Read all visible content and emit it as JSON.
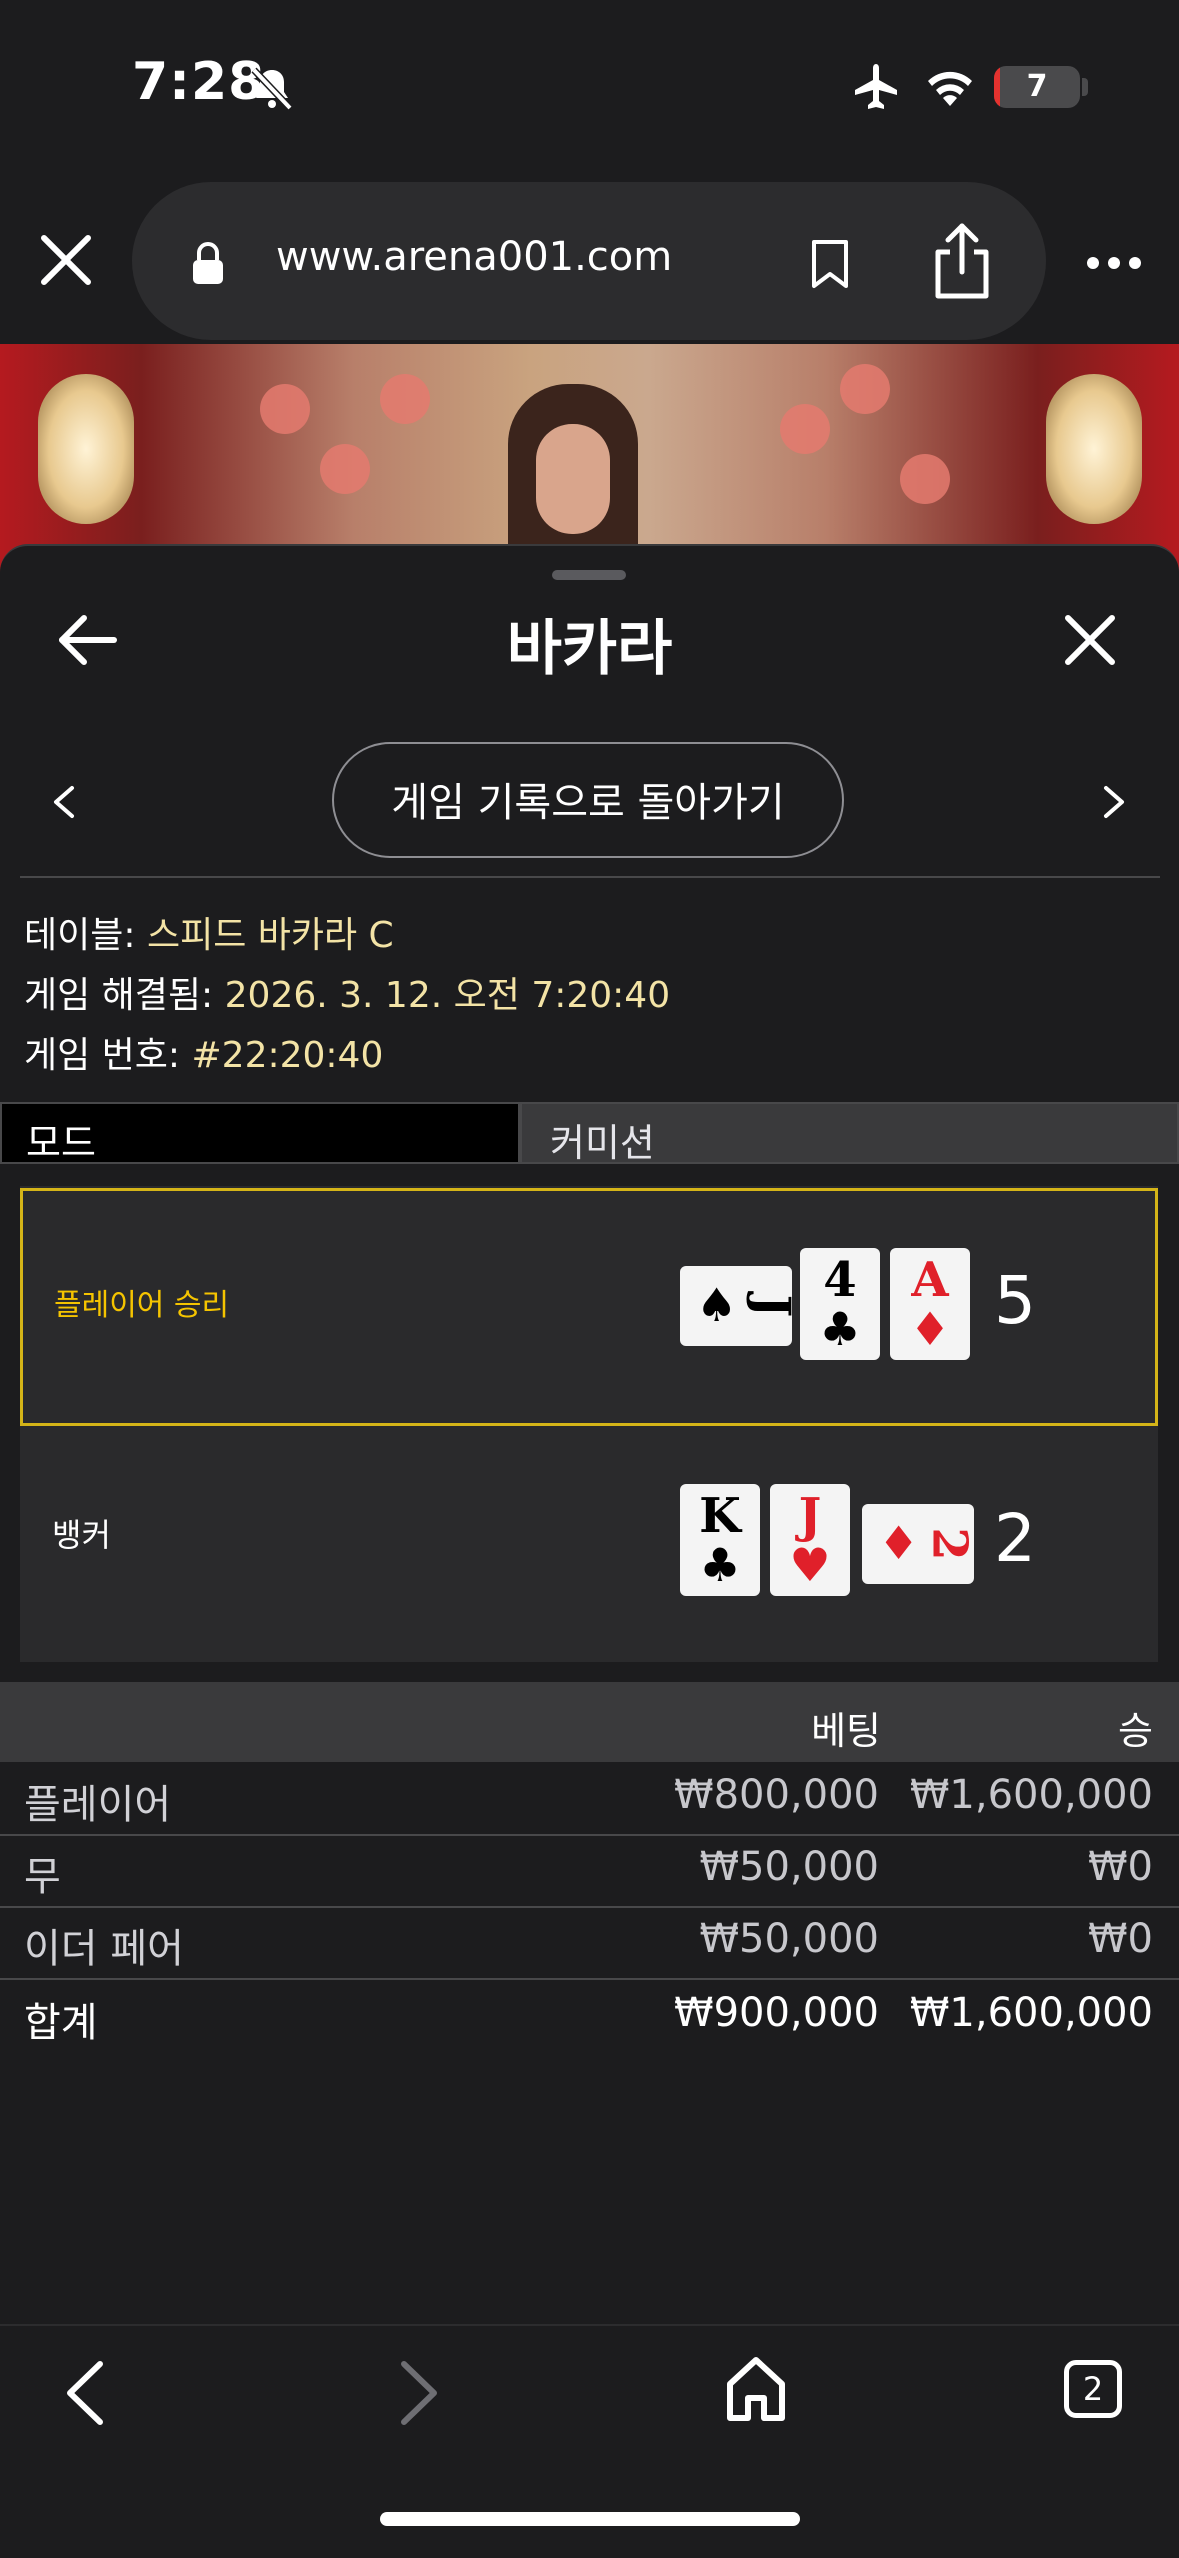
{
  "status_bar": {
    "time": "7:28",
    "battery": "7",
    "battery_level": 0.07
  },
  "browser": {
    "url": "www.arena001.com"
  },
  "sheet": {
    "title": "바카라",
    "back_to_history": "게임 기록으로 돌아가기"
  },
  "info": {
    "table_label": "테이블:",
    "table_value": "스피드 바카라 C",
    "resolved_label": "게임 해결됨:",
    "resolved_value": "2026. 3. 12. 오전 7:20:40",
    "game_no_label": "게임 번호:",
    "game_no_value": "#22:20:40"
  },
  "tabs": {
    "mode": "모드",
    "commission": "커미션"
  },
  "results": {
    "player": {
      "label": "플레이어 승리",
      "score": "5",
      "cards": [
        {
          "rank": "J",
          "suit": "♠",
          "color": "#000000",
          "orientation": "horizontal"
        },
        {
          "rank": "4",
          "suit": "♣",
          "color": "#000000",
          "orientation": "vertical"
        },
        {
          "rank": "A",
          "suit": "♦",
          "color": "#e0202a",
          "orientation": "vertical"
        }
      ]
    },
    "banker": {
      "label": "뱅커",
      "score": "2",
      "cards": [
        {
          "rank": "K",
          "suit": "♣",
          "color": "#000000",
          "orientation": "vertical"
        },
        {
          "rank": "J",
          "suit": "♥",
          "color": "#e0202a",
          "orientation": "vertical"
        },
        {
          "rank": "2",
          "suit": "♦",
          "color": "#e0202a",
          "orientation": "horizontal"
        }
      ]
    }
  },
  "bets": {
    "header_bet": "베팅",
    "header_win": "승",
    "rows": [
      {
        "name": "플레이어",
        "bet": "₩800,000",
        "win": "₩1,600,000"
      },
      {
        "name": "무",
        "bet": "₩50,000",
        "win": "₩0"
      },
      {
        "name": "이더 페어",
        "bet": "₩50,000",
        "win": "₩0"
      }
    ],
    "total": {
      "name": "합계",
      "bet": "₩900,000",
      "win": "₩1,600,000"
    }
  },
  "toolbar": {
    "tab_count": "2"
  },
  "colors": {
    "accent_yellow": "#f5c400",
    "highlight_border": "#d4b418",
    "info_value": "#f3e3a6"
  }
}
